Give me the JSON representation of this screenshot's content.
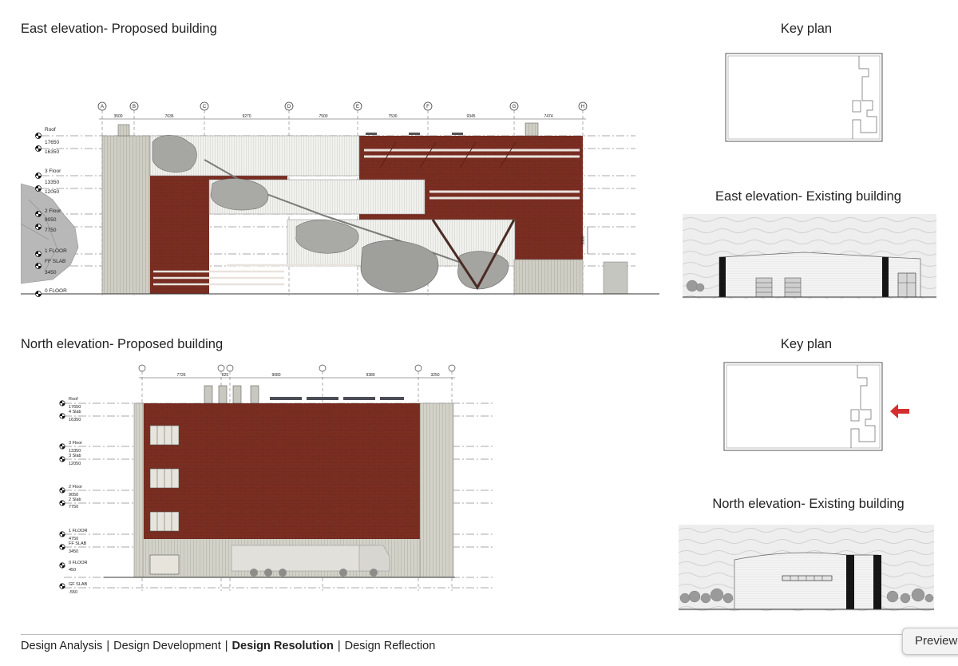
{
  "sections": {
    "east_proposed_title": "East elevation- Proposed building",
    "north_proposed_title": "North elevation- Proposed building",
    "key_plan_top_title": "Key plan",
    "key_plan_bottom_title": "Key plan",
    "east_existing_title": "East elevation- Existing building",
    "north_existing_title": "North elevation- Existing building"
  },
  "east_elevation": {
    "grid_labels": [
      "A",
      "B",
      "C",
      "D",
      "E",
      "F",
      "G",
      "H"
    ],
    "grid_dimensions": [
      "3500",
      "7636",
      "9270",
      "7500",
      "7530",
      "9345",
      "7474"
    ],
    "levels": [
      {
        "name": "Roof",
        "value": "17650"
      },
      {
        "name": "",
        "value": "16350"
      },
      {
        "name": "3 Floor",
        "value": "13350"
      },
      {
        "name": "",
        "value": "12050"
      },
      {
        "name": "2 Floor",
        "value": "9050"
      },
      {
        "name": "",
        "value": "7750"
      },
      {
        "name": "1 FLOOR",
        "value": ""
      },
      {
        "name": "FF SLAB",
        "value": "3450"
      },
      {
        "name": "0 FLOOR",
        "value": ""
      }
    ],
    "height_dimension": "3000"
  },
  "north_elevation": {
    "grid_dimensions": [
      "7726",
      "825",
      "9080",
      "9389",
      "3250"
    ],
    "levels": [
      {
        "name": "Roof",
        "value": "17650"
      },
      {
        "name": "4 Slab",
        "value": "16350"
      },
      {
        "name": "3 Floor",
        "value": "13350"
      },
      {
        "name": "3 Slab",
        "value": "12050"
      },
      {
        "name": "2 Floor",
        "value": "9050"
      },
      {
        "name": "2 Slab",
        "value": "7750"
      },
      {
        "name": "1 FLOOR",
        "value": "4750"
      },
      {
        "name": "FF SLAB",
        "value": "3450"
      },
      {
        "name": "0 FLOOR",
        "value": "450"
      },
      {
        "name": "GF SLAB",
        "value": "-550"
      }
    ]
  },
  "footer": {
    "items": [
      {
        "label": "Design Analysis",
        "active": false
      },
      {
        "label": "Design Development",
        "active": false
      },
      {
        "label": "Design Resolution",
        "active": true
      },
      {
        "label": "Design Reflection",
        "active": false
      }
    ],
    "separator": "|"
  },
  "preview_label": "Preview",
  "colors": {
    "brick": "#7a2e22",
    "cladding": "#c9c8bd",
    "arrow": "#d32f2f",
    "line": "#555555"
  },
  "icons": {
    "level_marker": "half-filled-circle-icon",
    "direction_arrow": "arrow-left-icon"
  }
}
